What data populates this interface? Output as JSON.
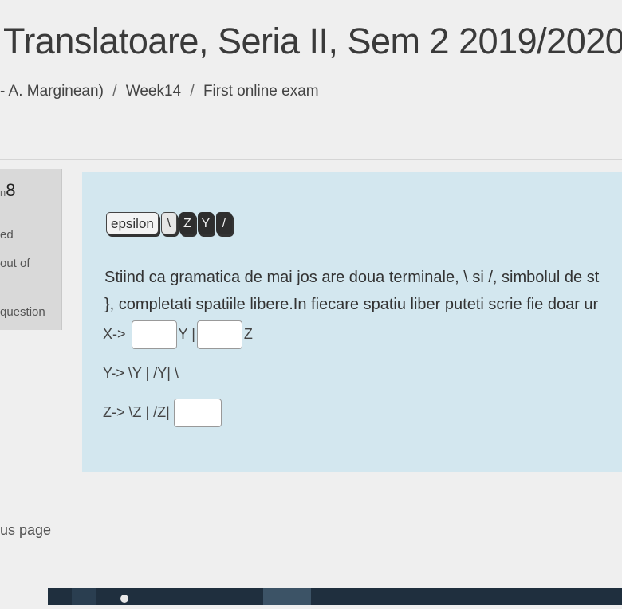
{
  "header": {
    "title": "Translatoare, Seria II, Sem 2 2019/2020",
    "breadcrumb": {
      "course": "- A. Marginean)",
      "sep": "/",
      "week": "Week14",
      "quiz": "First online exam"
    }
  },
  "question_info": {
    "number_prefix": "n",
    "number": "8",
    "status": "ed",
    "marks": "out of",
    "flag": "question"
  },
  "question": {
    "drag_items": [
      "epsilon",
      "\\",
      "Z",
      "Y",
      "/"
    ],
    "text_line1": "Stiind ca gramatica de mai jos are doua terminale, \\ si /, simbolul de st",
    "text_line2": "}, completati spatiile libere.In fiecare spatiu liber puteti scrie fie doar ur",
    "rule1": {
      "lhs": "X->",
      "mid": "Y |",
      "end": "Z"
    },
    "rule2": "Y-> \\Y | /Y| \\",
    "rule3": "Z-> \\Z | /Z|"
  },
  "nav": {
    "previous_page": "us page"
  },
  "colors": {
    "page_bg": "#efefef",
    "question_bg": "#d3e7ef",
    "info_bg": "#d9d9d9",
    "taskbar": "#1f2f3e"
  }
}
